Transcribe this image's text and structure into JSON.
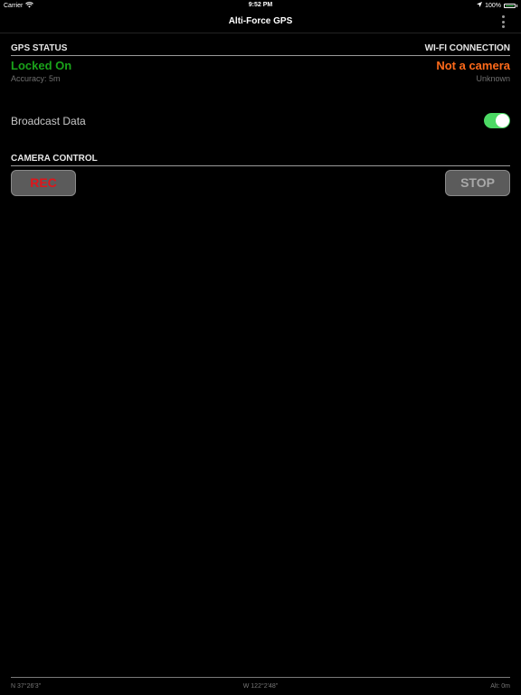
{
  "status_bar": {
    "carrier": "Carrier",
    "time": "9:52 PM",
    "battery_text": "100%",
    "icons": [
      "wifi-icon",
      "location-arrow-icon",
      "battery-icon"
    ]
  },
  "nav": {
    "title": "Alti-Force GPS",
    "menu_icon": "vertical-ellipsis-icon"
  },
  "gps_status": {
    "header": "GPS STATUS",
    "value": "Locked On",
    "value_color": "#1aa31a",
    "accuracy": "Accuracy: 5m"
  },
  "wifi": {
    "header": "WI-FI CONNECTION",
    "value": "Not a camera",
    "value_color": "#ff6a1a",
    "detail": "Unknown"
  },
  "broadcast": {
    "label": "Broadcast Data",
    "enabled": true,
    "toggle_color": "#4cd964"
  },
  "camera_control": {
    "header": "CAMERA CONTROL",
    "rec_label": "REC",
    "rec_color": "#e0151b",
    "stop_label": "STOP"
  },
  "footer": {
    "latitude": "N 37°26'3\"",
    "longitude": "W 122°2'48\"",
    "altitude": "Alt: 0m"
  }
}
